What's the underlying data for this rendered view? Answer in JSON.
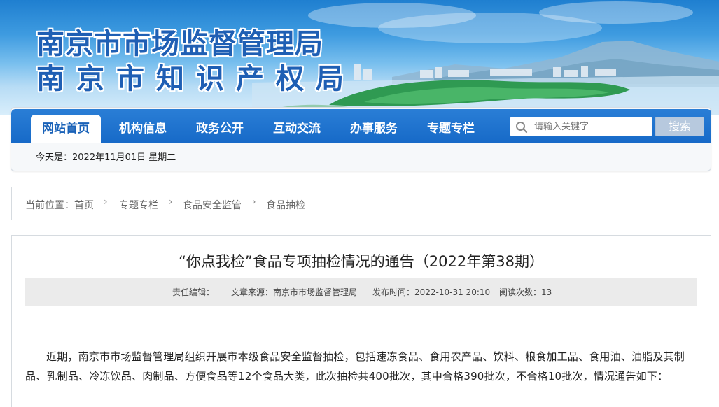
{
  "banner": {
    "title_line1": "南京市市场监督管理局",
    "title_line2": "南京市知识产权局"
  },
  "nav": {
    "items": [
      {
        "label": "网站首页",
        "active": true
      },
      {
        "label": "机构信息",
        "active": false
      },
      {
        "label": "政务公开",
        "active": false
      },
      {
        "label": "互动交流",
        "active": false
      },
      {
        "label": "办事服务",
        "active": false
      },
      {
        "label": "专题专栏",
        "active": false
      }
    ]
  },
  "search": {
    "placeholder": "请输入关键字",
    "button_label": "搜索"
  },
  "date_line": "今天是：2022年11月01日 星期二",
  "breadcrumb": {
    "label": "当前位置：",
    "items": [
      "首页",
      "专题专栏",
      "食品安全监管",
      "食品抽检"
    ],
    "separator": "›"
  },
  "article": {
    "title": "“你点我检”食品专项抽检情况的通告（2022年第38期）",
    "meta": {
      "editor": "责任编辑：",
      "source": "文章来源：南京市市场监督管理局",
      "published": "发布时间：2022-10-31 20:10",
      "views": "阅读次数：13"
    },
    "paragraph": "近期，南京市市场监督管理局组织开展市本级食品安全监督抽检，包括速冻食品、食用农产品、饮料、粮食加工品、食用油、油脂及其制品、乳制品、冷冻饮品、肉制品、方便食品等12个食品大类，此次抽检共400批次，其中合格390批次，不合格10批次，情况通告如下："
  },
  "colors": {
    "nav_blue": "#1f74cf",
    "title_blue": "#1f5fb4",
    "meta_bg": "#ebebeb"
  }
}
